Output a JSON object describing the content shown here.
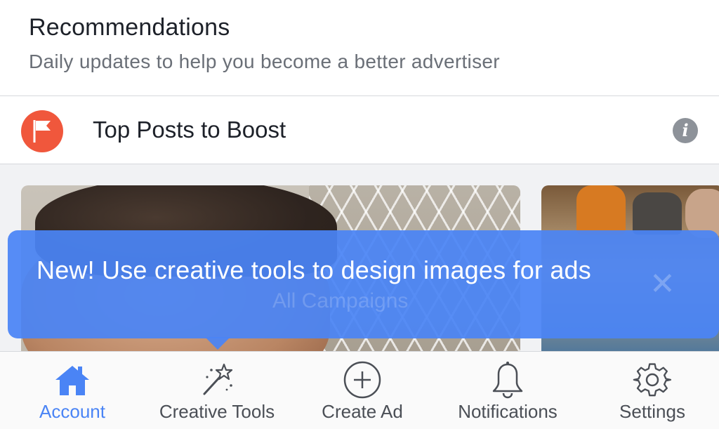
{
  "header": {
    "title": "Recommendations",
    "subtitle": "Daily updates to help you become a better advertiser"
  },
  "section": {
    "title": "Top Posts to Boost",
    "info_icon": "info-icon",
    "flag_icon": "flag-icon",
    "flag_color": "#f0573c"
  },
  "tooltip": {
    "text": "New! Use creative tools to design images for ads",
    "background_behind_text": "All Campaigns",
    "color": "#4a84f5"
  },
  "tabbar": {
    "tabs": [
      {
        "label": "Account",
        "icon": "home-icon",
        "active": true
      },
      {
        "label": "Creative Tools",
        "icon": "magic-wand-icon",
        "active": false
      },
      {
        "label": "Create Ad",
        "icon": "plus-circle-icon",
        "active": false
      },
      {
        "label": "Notifications",
        "icon": "bell-icon",
        "active": false
      },
      {
        "label": "Settings",
        "icon": "gear-icon",
        "active": false
      }
    ],
    "active_color": "#4a84f5",
    "inactive_color": "#4b4f56"
  }
}
